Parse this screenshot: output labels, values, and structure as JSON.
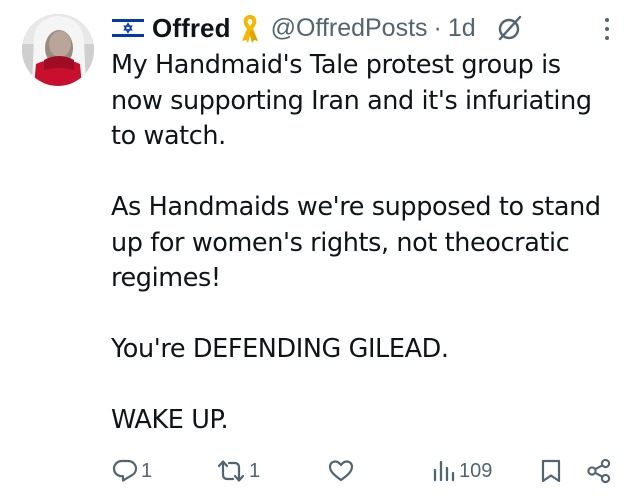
{
  "author": {
    "display_name": "Offred",
    "handle": "@OffredPosts",
    "separator": "·",
    "time": "1d",
    "flag_icon": "israel-flag-icon",
    "badge_icon": "yellow-ribbon-icon"
  },
  "body": {
    "paragraphs": [
      "My Handmaid's Tale protest group is now supporting Iran and it's infuriating to watch.",
      "As Handmaids we're supposed to stand up for women's rights, not theocratic regimes!",
      "You're DEFENDING GILEAD.",
      "WAKE UP."
    ]
  },
  "actions": {
    "reply_count": "1",
    "retweet_count": "1",
    "like_count": "",
    "view_count": "109"
  },
  "colors": {
    "text": "#0f1419",
    "secondary": "#536471",
    "flag_blue": "#0038b8",
    "ribbon": "#f5b800",
    "hood_red": "#c8102e"
  }
}
